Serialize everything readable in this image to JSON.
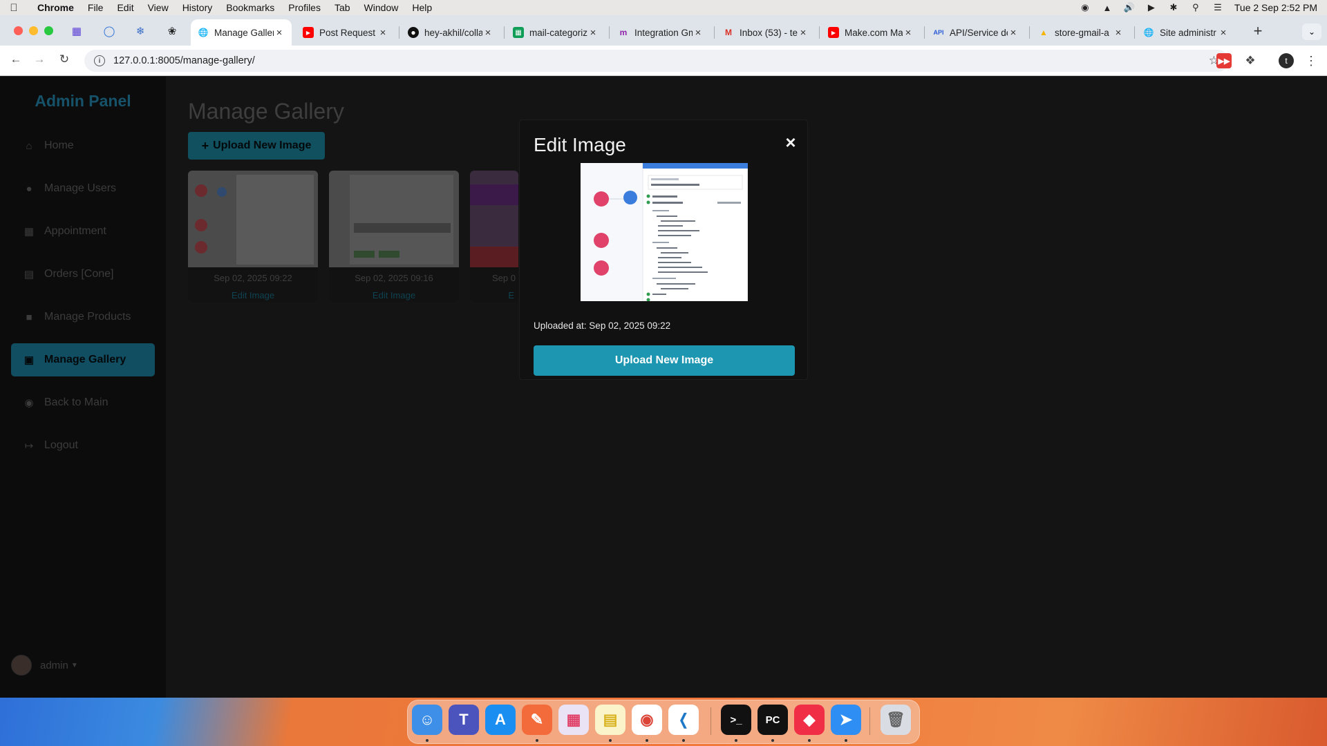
{
  "menubar": {
    "app": "Chrome",
    "items": [
      "File",
      "Edit",
      "View",
      "History",
      "Bookmarks",
      "Profiles",
      "Tab",
      "Window",
      "Help"
    ],
    "clock": "Tue 2 Sep  2:52 PM"
  },
  "tabs": [
    {
      "title": "Manage Galler",
      "active": true
    },
    {
      "title": "Post Request",
      "active": false
    },
    {
      "title": "hey-akhil/colla",
      "active": false
    },
    {
      "title": "mail-categoriz",
      "active": false
    },
    {
      "title": "Integration Gm",
      "active": false
    },
    {
      "title": "Inbox (53) - te",
      "active": false
    },
    {
      "title": "Make.com Ma",
      "active": false
    },
    {
      "title": "API/Service de",
      "active": false
    },
    {
      "title": "store-gmail-a",
      "active": false
    },
    {
      "title": "Site administr",
      "active": false
    }
  ],
  "address": {
    "url": "127.0.0.1:8005/manage-gallery/"
  },
  "profile_initial": "t",
  "sidebar": {
    "brand": "Admin Panel",
    "items": [
      {
        "label": "Home",
        "icon": "home-icon",
        "active": false
      },
      {
        "label": "Manage Users",
        "icon": "user-icon",
        "active": false
      },
      {
        "label": "Appointment",
        "icon": "calendar-icon",
        "active": false
      },
      {
        "label": "Orders [Cone]",
        "icon": "document-icon",
        "active": false
      },
      {
        "label": "Manage Products",
        "icon": "box-icon",
        "active": false
      },
      {
        "label": "Manage Gallery",
        "icon": "image-icon",
        "active": true
      },
      {
        "label": "Back to Main",
        "icon": "globe-icon",
        "active": false
      },
      {
        "label": "Logout",
        "icon": "logout-icon",
        "active": false
      }
    ],
    "user": "admin"
  },
  "main": {
    "title": "Manage Gallery",
    "upload_label": "Upload New Image",
    "cards": [
      {
        "date": "Sep 02, 2025 09:22",
        "edit": "Edit Image"
      },
      {
        "date": "Sep 02, 2025 09:16",
        "edit": "Edit Image"
      },
      {
        "date": "Sep 0",
        "edit": "E"
      }
    ]
  },
  "modal": {
    "title": "Edit Image",
    "close": "×",
    "uploaded_at": "Uploaded at: Sep 02, 2025 09:22",
    "button": "Upload New Image"
  },
  "colors": {
    "accent": "#1c96b1",
    "sidebar_active": "#114e62",
    "brand": "#16536a"
  }
}
